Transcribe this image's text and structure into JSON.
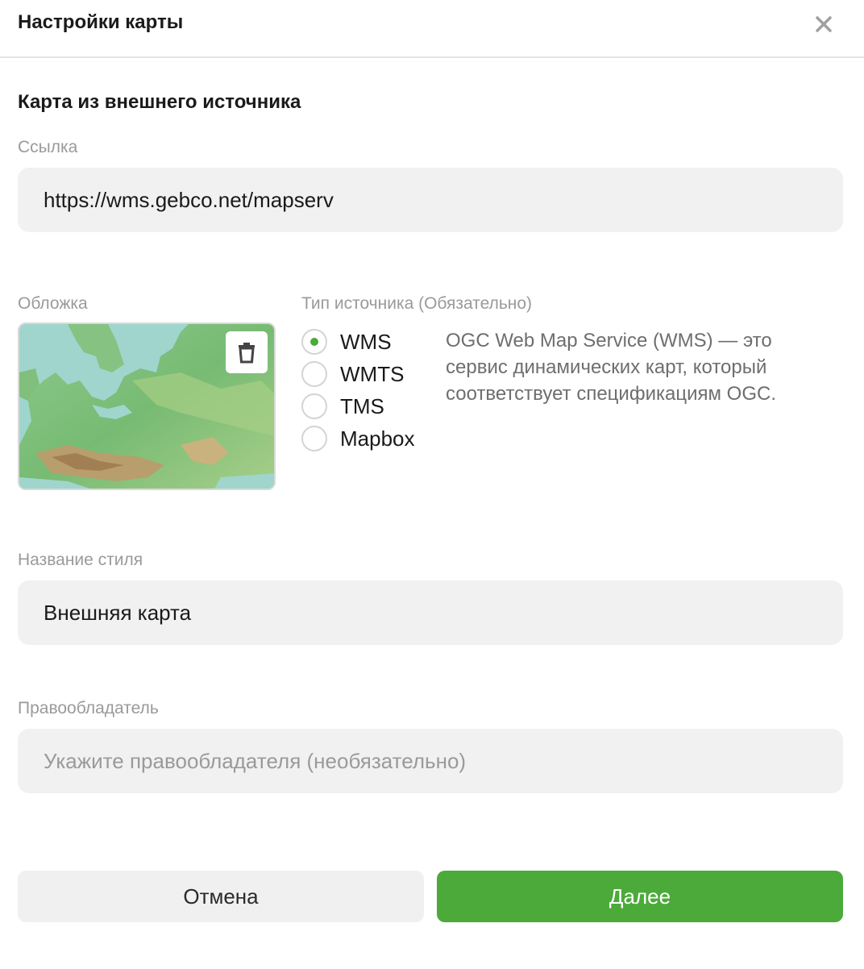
{
  "header": {
    "title": "Настройки карты",
    "close_icon": "close-icon"
  },
  "section_title": "Карта из внешнего источника",
  "link": {
    "label": "Ссылка",
    "value": "https://wms.gebco.net/mapserv"
  },
  "cover": {
    "label": "Обложка",
    "delete_icon": "trash-icon"
  },
  "source_type": {
    "label": "Тип источника (Обязательно)",
    "options": [
      {
        "label": "WMS",
        "selected": true
      },
      {
        "label": "WMTS",
        "selected": false
      },
      {
        "label": "TMS",
        "selected": false
      },
      {
        "label": "Mapbox",
        "selected": false
      }
    ],
    "description": "OGC Web Map Service (WMS) — это сервис динамических карт, который соответствует спецификациям OGC."
  },
  "style_name": {
    "label": "Название стиля",
    "value": "Внешняя карта"
  },
  "copyright": {
    "label": "Правообладатель",
    "placeholder": "Укажите правообладателя (необязательно)"
  },
  "buttons": {
    "cancel": "Отмена",
    "next": "Далее"
  },
  "colors": {
    "accent": "#4caa3a",
    "field_bg": "#f1f1f1",
    "label": "#9a9a9a"
  }
}
